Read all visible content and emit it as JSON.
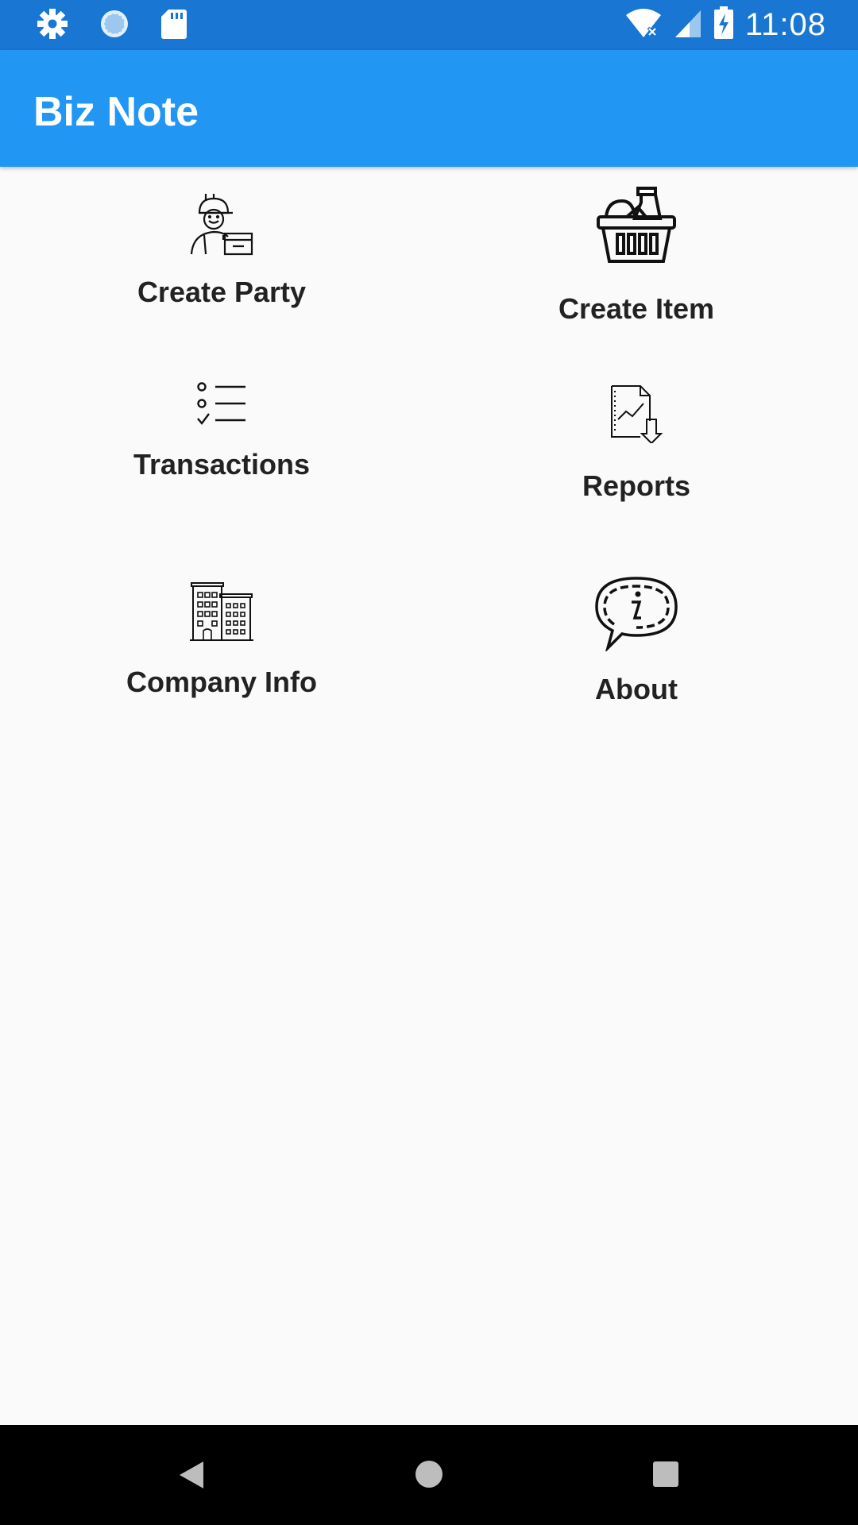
{
  "status_bar": {
    "time": "11:08",
    "icons_left": [
      "gear-icon",
      "loading-icon",
      "sd-card-icon"
    ],
    "icons_right": [
      "wifi-icon",
      "signal-icon",
      "battery-charging-icon"
    ]
  },
  "app_bar": {
    "title": "Biz Note"
  },
  "menu": {
    "items": [
      {
        "label": "Create Party",
        "icon": "delivery-person-icon"
      },
      {
        "label": "Create Item",
        "icon": "grocery-basket-icon"
      },
      {
        "label": "Transactions",
        "icon": "checklist-icon"
      },
      {
        "label": "Reports",
        "icon": "report-download-icon"
      },
      {
        "label": "Company Info",
        "icon": "buildings-icon"
      },
      {
        "label": "About",
        "icon": "info-speech-bubble-icon"
      }
    ]
  },
  "nav_bar": {
    "buttons": [
      "back-icon",
      "home-icon",
      "recents-icon"
    ]
  },
  "colors": {
    "status_bar": "#1976d2",
    "app_bar": "#2196f3",
    "background": "#fafafa",
    "label": "#222222"
  }
}
